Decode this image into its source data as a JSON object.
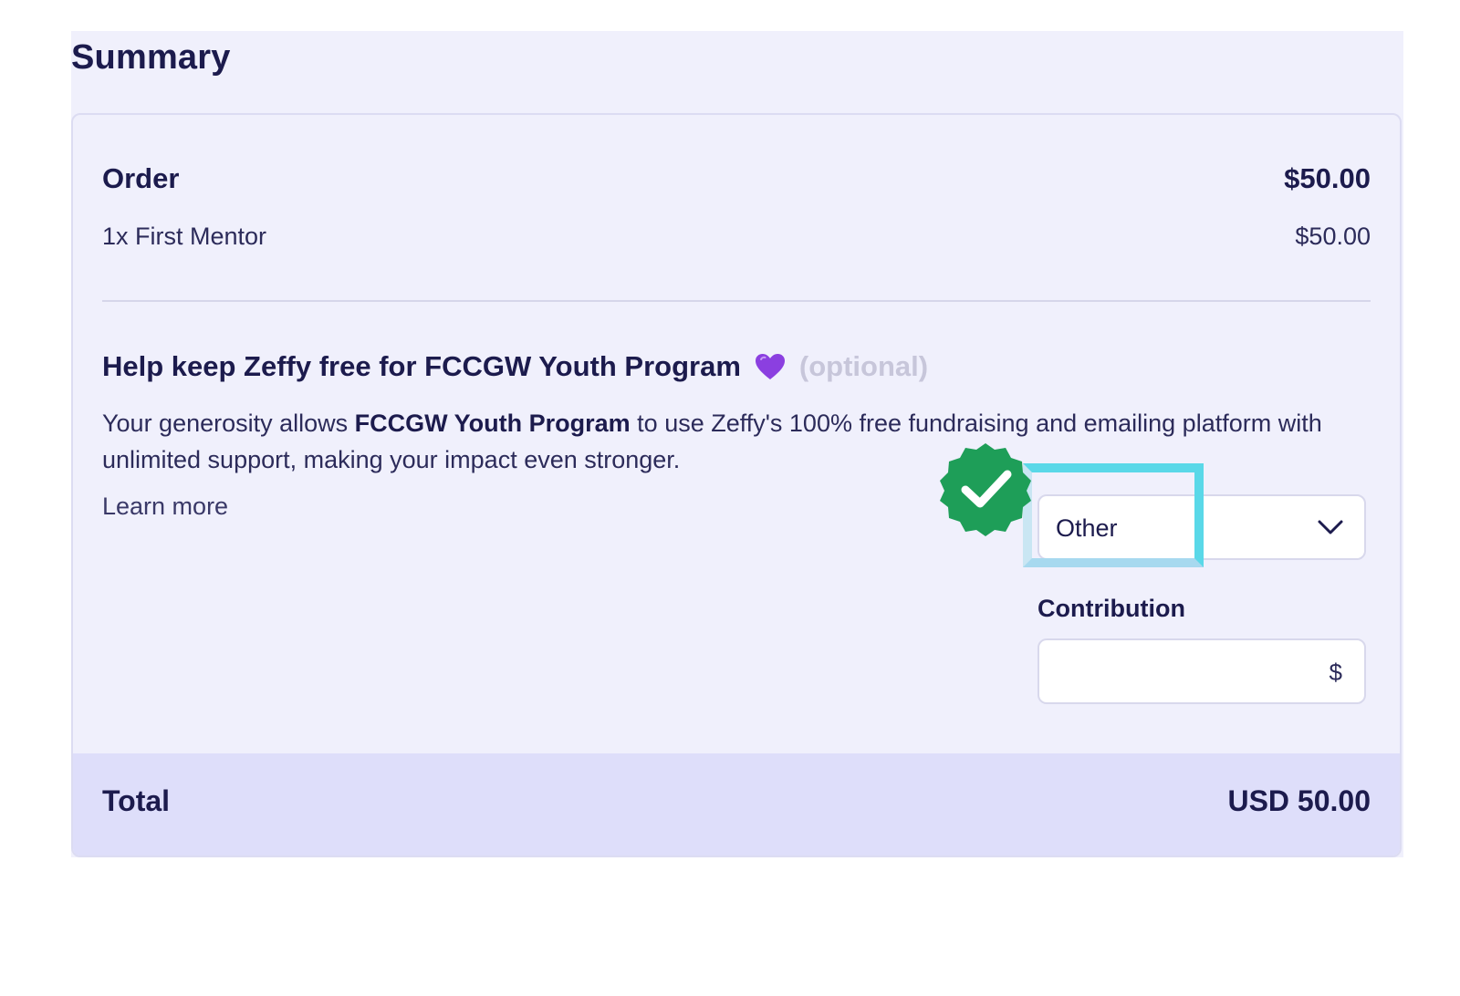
{
  "summary": {
    "title": "Summary"
  },
  "order": {
    "label": "Order",
    "amount": "$50.00",
    "items": [
      {
        "label": "1x First Mentor",
        "amount": "$50.00"
      }
    ]
  },
  "tip": {
    "title": "Help keep Zeffy free for FCCGW Youth Program",
    "heart_icon": "purple-heart-icon",
    "optional_label": "(optional)",
    "description_before": "Your generosity allows ",
    "description_org": "FCCGW Youth Program",
    "description_after": " to use Zeffy's 100% free fundraising and emailing platform with unlimited support, making your impact even stronger.",
    "learn_more": "Learn more",
    "select": {
      "selected": "Other"
    },
    "contribution": {
      "label": "Contribution",
      "value": "",
      "currency": "$"
    }
  },
  "total": {
    "label": "Total",
    "amount": "USD 50.00"
  },
  "colors": {
    "accent_check": "#1e9e58",
    "highlight": "#5ad8e8",
    "heart": "#8b3fe0"
  }
}
